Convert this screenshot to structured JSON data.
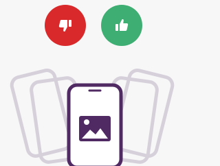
{
  "rating": {
    "dislike": {
      "icon": "thumbs-down-icon",
      "color": "#d9292a"
    },
    "like": {
      "icon": "thumbs-up-icon",
      "color": "#3fae73"
    }
  },
  "illustration": {
    "icon": "image-placeholder-icon",
    "accent_color": "#4f2a63",
    "ghost_color": "#d6d0db"
  }
}
